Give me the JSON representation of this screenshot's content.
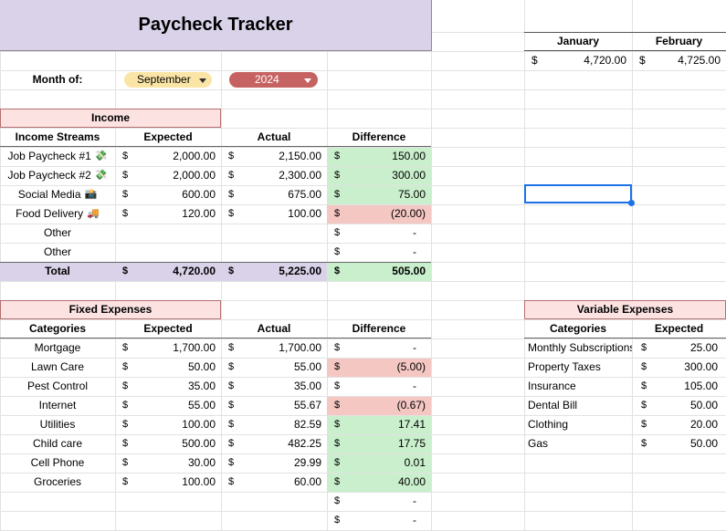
{
  "title": "Paycheck Tracker",
  "month_label": "Month of:",
  "month_value": "September",
  "year_value": "2024",
  "colors": {
    "title_bg": "#d9d2e9",
    "header_bg": "#fce3e2",
    "positive_bg": "#c9efcc",
    "negative_bg": "#f4c7c3",
    "month_chip": "#fbe5a6",
    "year_chip": "#c66262",
    "selection": "#1a73e8"
  },
  "summary": {
    "headers": [
      "January",
      "February"
    ],
    "currency": "$",
    "values": [
      "4,720.00",
      "4,725.00"
    ]
  },
  "income": {
    "title": "Income",
    "columns": [
      "Income Streams",
      "Expected",
      "Actual",
      "Difference"
    ],
    "rows": [
      {
        "name": "Job Paycheck #1",
        "icon": "money-icon",
        "expected": "2,000.00",
        "actual": "2,150.00",
        "diff": "150.00",
        "status": "positive"
      },
      {
        "name": "Job Paycheck #2",
        "icon": "money-icon",
        "expected": "2,000.00",
        "actual": "2,300.00",
        "diff": "300.00",
        "status": "positive"
      },
      {
        "name": "Social Media",
        "icon": "camera-icon",
        "expected": "600.00",
        "actual": "675.00",
        "diff": "75.00",
        "status": "positive"
      },
      {
        "name": "Food Delivery",
        "icon": "truck-icon",
        "expected": "120.00",
        "actual": "100.00",
        "diff": "(20.00)",
        "status": "negative"
      },
      {
        "name": "Other",
        "icon": "",
        "expected": "",
        "actual": "",
        "diff": "-",
        "status": "none"
      },
      {
        "name": "Other",
        "icon": "",
        "expected": "",
        "actual": "",
        "diff": "-",
        "status": "none"
      }
    ],
    "total": {
      "label": "Total",
      "expected": "4,720.00",
      "actual": "5,225.00",
      "diff": "505.00"
    }
  },
  "fixed": {
    "title": "Fixed Expenses",
    "columns": [
      "Categories",
      "Expected",
      "Actual",
      "Difference"
    ],
    "rows": [
      {
        "name": "Mortgage",
        "expected": "1,700.00",
        "actual": "1,700.00",
        "diff": "-",
        "status": "none"
      },
      {
        "name": "Lawn Care",
        "expected": "50.00",
        "actual": "55.00",
        "diff": "(5.00)",
        "status": "negative"
      },
      {
        "name": "Pest Control",
        "expected": "35.00",
        "actual": "35.00",
        "diff": "-",
        "status": "none"
      },
      {
        "name": "Internet",
        "expected": "55.00",
        "actual": "55.67",
        "diff": "(0.67)",
        "status": "negative"
      },
      {
        "name": "Utilities",
        "expected": "100.00",
        "actual": "82.59",
        "diff": "17.41",
        "status": "positive"
      },
      {
        "name": "Child care",
        "expected": "500.00",
        "actual": "482.25",
        "diff": "17.75",
        "status": "positive"
      },
      {
        "name": "Cell Phone",
        "expected": "30.00",
        "actual": "29.99",
        "diff": "0.01",
        "status": "positive"
      },
      {
        "name": "Groceries",
        "expected": "100.00",
        "actual": "60.00",
        "diff": "40.00",
        "status": "positive"
      },
      {
        "name": "",
        "expected": "",
        "actual": "",
        "diff": "-",
        "status": "none"
      },
      {
        "name": "",
        "expected": "",
        "actual": "",
        "diff": "-",
        "status": "none"
      }
    ]
  },
  "variable": {
    "title": "Variable Expenses",
    "columns": [
      "Categories",
      "Expected"
    ],
    "rows": [
      {
        "name": "Monthly Subscriptions",
        "expected": "25.00"
      },
      {
        "name": "Property Taxes",
        "expected": "300.00"
      },
      {
        "name": "Insurance",
        "expected": "105.00"
      },
      {
        "name": "Dental Bill",
        "expected": "50.00"
      },
      {
        "name": "Clothing",
        "expected": "20.00"
      },
      {
        "name": "Gas",
        "expected": "50.00"
      }
    ]
  }
}
